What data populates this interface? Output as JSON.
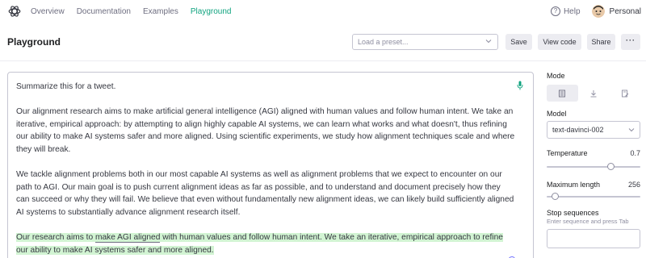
{
  "nav": {
    "logo_icon": "openai-logo-icon",
    "links": [
      "Overview",
      "Documentation",
      "Examples",
      "Playground"
    ],
    "active_link": "Playground",
    "help_label": "Help",
    "account_label": "Personal"
  },
  "header": {
    "title": "Playground",
    "preset_placeholder": "Load a preset...",
    "save_label": "Save",
    "view_code_label": "View code",
    "share_label": "Share",
    "more_label": "···"
  },
  "editor": {
    "prompt_line": "Summarize this for a tweet.",
    "paragraph_1": "Our alignment research aims to make artificial general intelligence (AGI) aligned with human values and follow human intent. We take an iterative, empirical approach: by attempting to align highly capable AI systems, we can learn what works and what doesn't, thus refining our ability to make AI systems safer and more aligned. Using scientific experiments, we study how alignment techniques scale and where they will break.",
    "paragraph_2": "We tackle alignment problems both in our most capable AI systems as well as alignment problems that we expect to encounter on our path to AGI. Our main goal is to push current alignment ideas as far as possible, and to understand and document precisely how they can succeed or why they will fail. We believe that even without fundamentally new alignment ideas, we can likely build sufficiently aligned AI systems to substantially advance alignment research itself.",
    "completion_before": "Our research aims to ",
    "completion_underlined": "make AGI aligned",
    "completion_after": " with human values and follow human intent. We take an iterative, empirical approach to refine our ability to make AI systems safer and more aligned.",
    "highlight_color": "#d2f4d3"
  },
  "settings": {
    "mode_label": "Mode",
    "mode_icons": [
      "complete-mode-icon",
      "insert-mode-icon",
      "edit-mode-icon"
    ],
    "active_mode": 0,
    "model_label": "Model",
    "model_value": "text-davinci-002",
    "temperature_label": "Temperature",
    "temperature_value": "0.7",
    "temperature_fraction": 0.7,
    "max_length_label": "Maximum length",
    "max_length_value": "256",
    "max_length_fraction": 0.06,
    "stop_label": "Stop sequences",
    "stop_hint": "Enter sequence and press Tab"
  },
  "colors": {
    "accent": "#10a37f",
    "text": "#353740",
    "muted": "#6e6e80",
    "button_bg": "#ececf1",
    "border": "#c5c5d2"
  }
}
